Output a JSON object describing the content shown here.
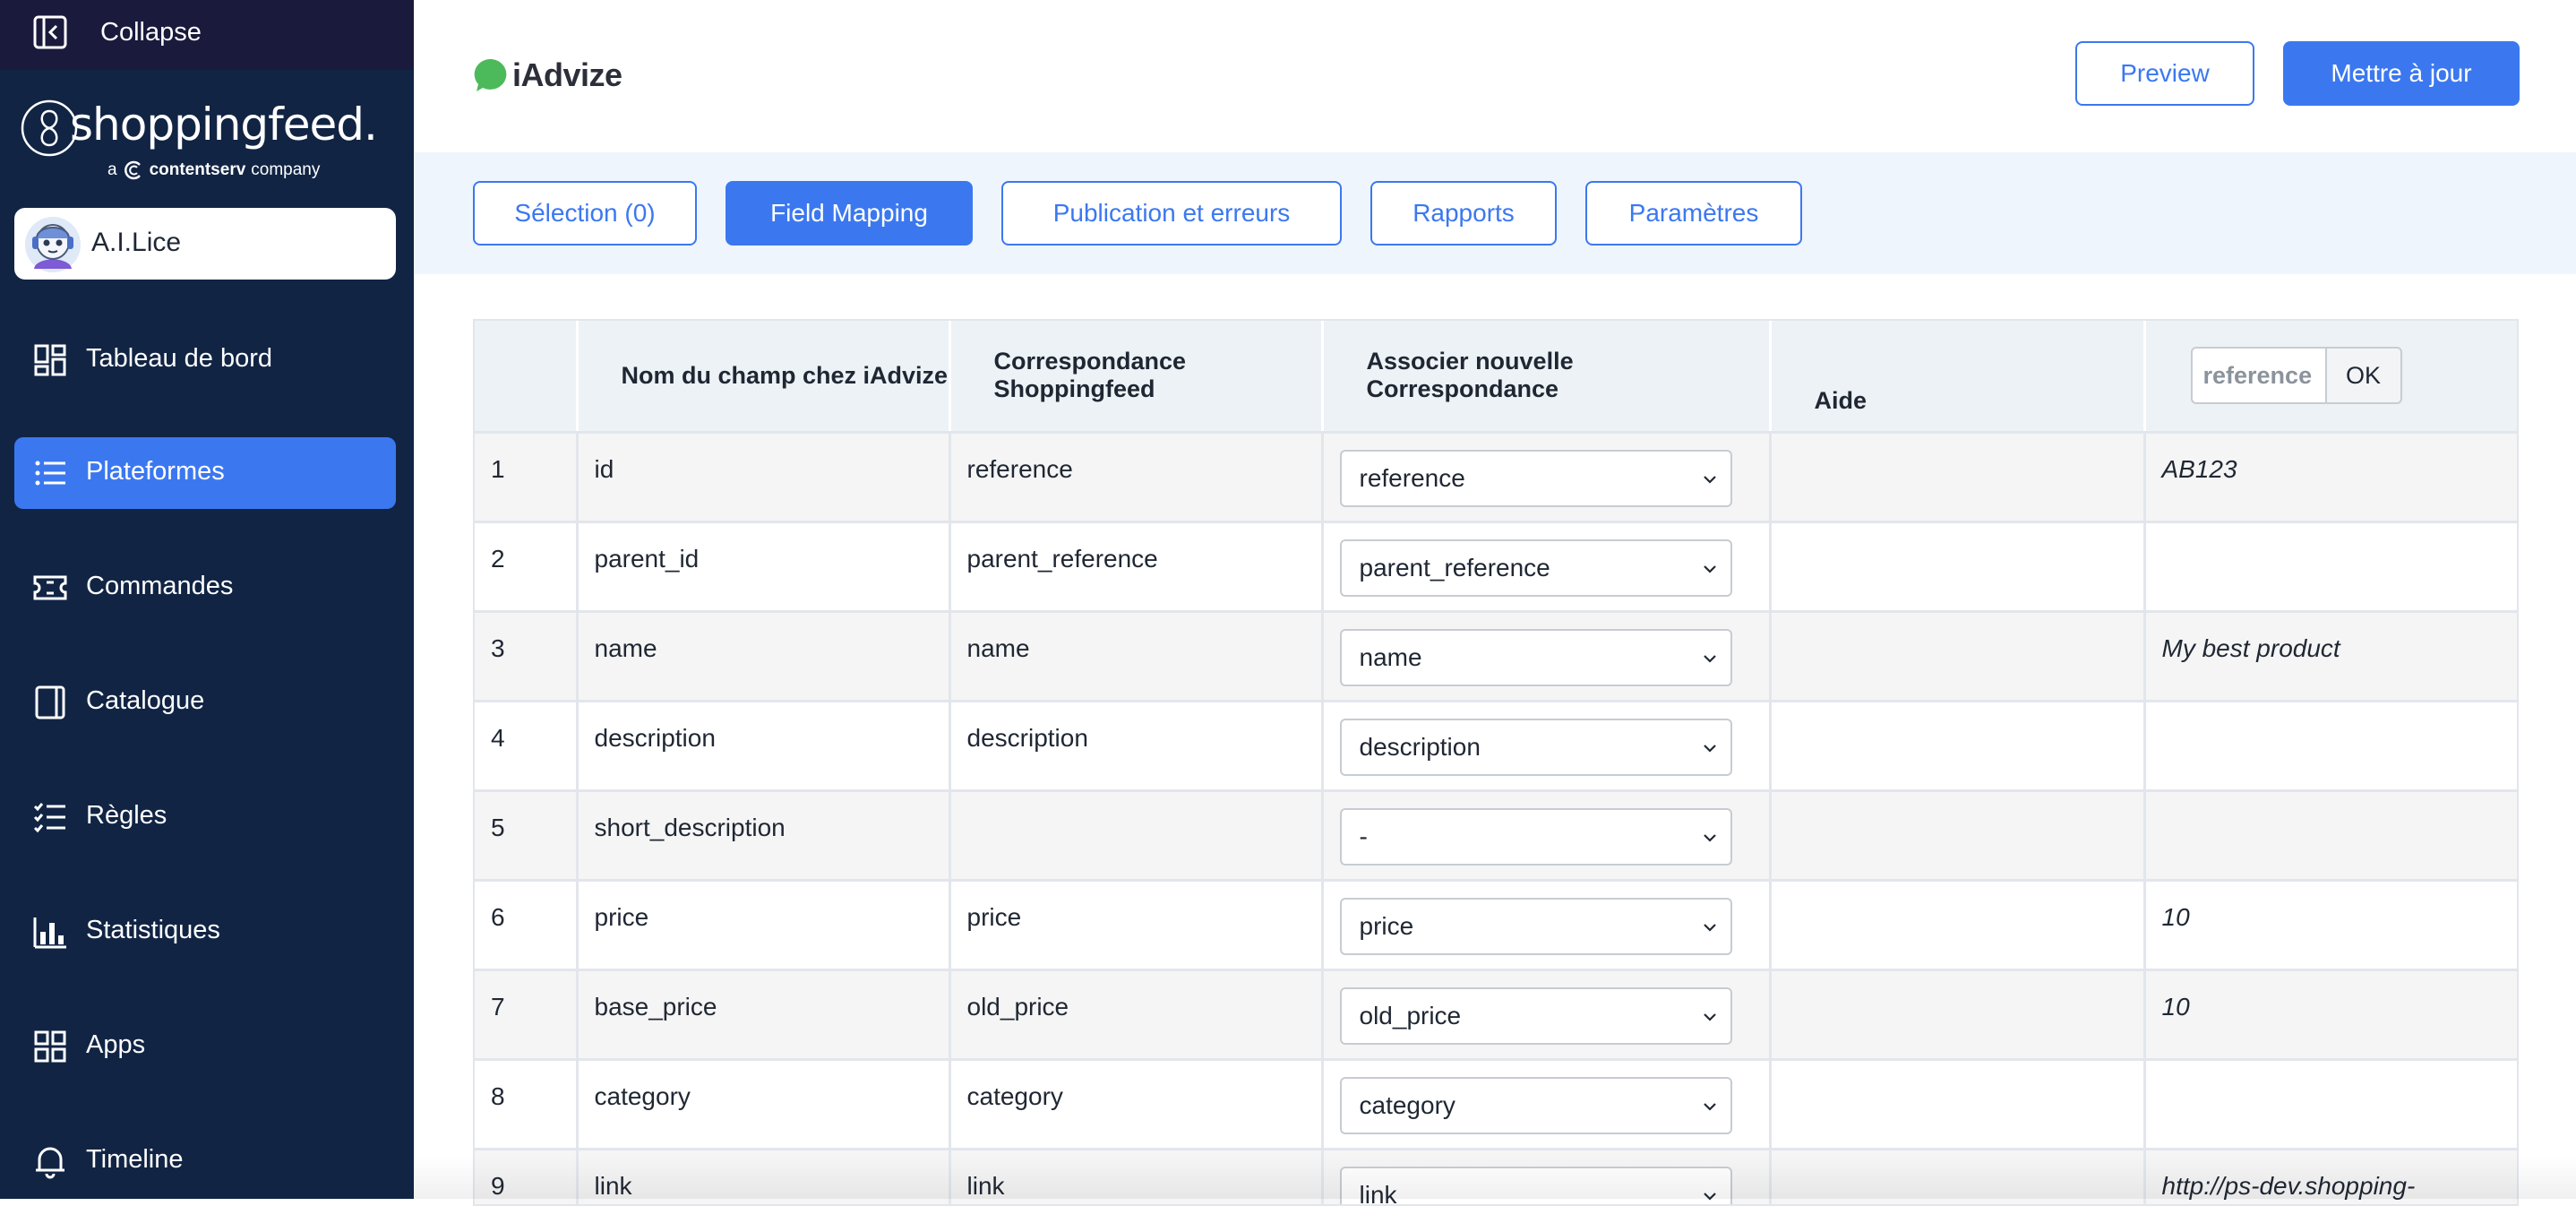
{
  "sidebar": {
    "collapse_label": "Collapse",
    "brand": {
      "name": "shoppingfeed.",
      "tagline_prefix": "a",
      "tagline_company": "contentserv",
      "tagline_suffix": "company"
    },
    "assistant_label": "A.I.Lice",
    "items": [
      {
        "label": "Tableau de bord",
        "icon": "dashboard-icon",
        "active": false
      },
      {
        "label": "Plateformes",
        "icon": "list-icon",
        "active": true
      },
      {
        "label": "Commandes",
        "icon": "ticket-icon",
        "active": false
      },
      {
        "label": "Catalogue",
        "icon": "book-icon",
        "active": false
      },
      {
        "label": "Règles",
        "icon": "checklist-icon",
        "active": false
      },
      {
        "label": "Statistiques",
        "icon": "bar-chart-icon",
        "active": false
      },
      {
        "label": "Apps",
        "icon": "apps-grid-icon",
        "active": false
      },
      {
        "label": "Timeline",
        "icon": "bell-icon",
        "active": false
      }
    ]
  },
  "header": {
    "channel_name": "iAdvize",
    "preview_label": "Preview",
    "update_label": "Mettre à jour"
  },
  "tabs": [
    {
      "label": "Sélection (0)",
      "active": false
    },
    {
      "label": "Field Mapping",
      "active": true
    },
    {
      "label": "Publication et erreurs",
      "active": false
    },
    {
      "label": "Rapports",
      "active": false
    },
    {
      "label": "Paramètres",
      "active": false
    }
  ],
  "table": {
    "headers": {
      "index": "",
      "field_name": "Nom du champ chez iAdvize",
      "mapping": "Correspondance Shoppingfeed",
      "new_mapping": "Associer nouvelle Correspondance",
      "help": "Aide",
      "search_value": "reference",
      "ok_label": "OK"
    },
    "rows": [
      {
        "num": "1",
        "field": "id",
        "mapping": "reference",
        "select": "reference",
        "help": "",
        "example": "AB123"
      },
      {
        "num": "2",
        "field": "parent_id",
        "mapping": "parent_reference",
        "select": "parent_reference",
        "help": "",
        "example": ""
      },
      {
        "num": "3",
        "field": "name",
        "mapping": "name",
        "select": "name",
        "help": "",
        "example": "My best product"
      },
      {
        "num": "4",
        "field": "description",
        "mapping": "description",
        "select": "description",
        "help": "",
        "example": ""
      },
      {
        "num": "5",
        "field": "short_description",
        "mapping": "",
        "select": "-",
        "help": "",
        "example": ""
      },
      {
        "num": "6",
        "field": "price",
        "mapping": "price",
        "select": "price",
        "help": "",
        "example": "10"
      },
      {
        "num": "7",
        "field": "base_price",
        "mapping": "old_price",
        "select": "old_price",
        "help": "",
        "example": "10"
      },
      {
        "num": "8",
        "field": "category",
        "mapping": "category",
        "select": "category",
        "help": "",
        "example": ""
      },
      {
        "num": "9",
        "field": "link",
        "mapping": "link",
        "select": "link",
        "help": "",
        "example": "http://ps-dev.shopping-"
      }
    ]
  },
  "colors": {
    "accent": "#3b78f0",
    "sidebar_bg": "#112444",
    "collapse_bg": "#1a1a3d",
    "tabs_band_bg": "#eef5fd",
    "logo_green": "#4cba5a"
  }
}
